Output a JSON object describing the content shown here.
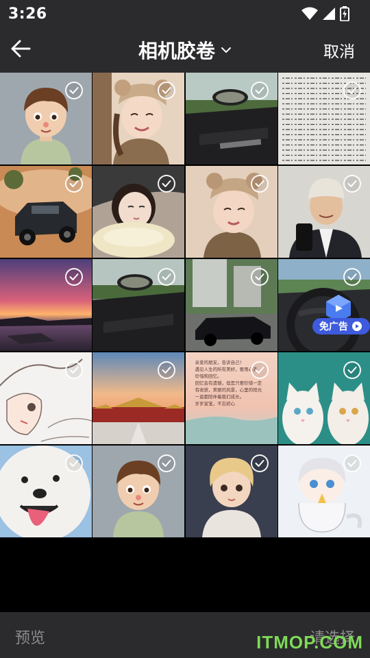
{
  "status": {
    "time": "3:26"
  },
  "nav": {
    "title": "相机胶卷",
    "cancel_label": "取消"
  },
  "bottom": {
    "preview_label": "预览",
    "select_label": "请选择"
  },
  "ad": {
    "label": "免广告"
  },
  "watermark": "ITMOP.COM",
  "photos": [
    {
      "name": "photo-cartoon-boy"
    },
    {
      "name": "photo-girl-bear-hat"
    },
    {
      "name": "photo-car-interior"
    },
    {
      "name": "photo-handwritten-text"
    },
    {
      "name": "photo-offroad-suv"
    },
    {
      "name": "photo-girl-lying"
    },
    {
      "name": "photo-girl-bear-hat-2"
    },
    {
      "name": "photo-man-beanie"
    },
    {
      "name": "photo-sunset-sea"
    },
    {
      "name": "photo-car-interior-2"
    },
    {
      "name": "photo-black-sedan"
    },
    {
      "name": "photo-steering-wheel"
    },
    {
      "name": "photo-anime-sketch"
    },
    {
      "name": "photo-forbidden-city"
    },
    {
      "name": "photo-note-text"
    },
    {
      "name": "photo-white-kittens"
    },
    {
      "name": "photo-white-dog"
    },
    {
      "name": "photo-cartoon-boy-2"
    },
    {
      "name": "photo-cartoon-girl"
    },
    {
      "name": "photo-chibi-star"
    }
  ],
  "note_lines": [
    "亲爱的朋友，告诉自己！",
    "遇见人生的所有美好，要用心去",
    "珍惜和回忆。",
    "回忆会有遗憾，但是只要珍惜一定",
    "有收获，美丽的风景，心里的阳光",
    "一直都陪伴着我们成长。",
    "岁岁宣宝，不忘初心"
  ],
  "colors": {
    "bar": "#2b2b2d",
    "accent": "#3d5bdc",
    "watermark": "#7ed957"
  }
}
